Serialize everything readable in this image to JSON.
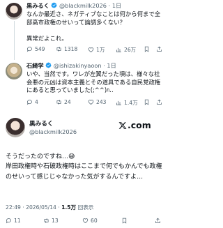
{
  "tweet1": {
    "name": "黒みるく",
    "handle": "@blackmilk2026",
    "separator": "·",
    "time": "1日",
    "text": "なんか最近さ、ネガティブなことは何から何まで全部高市政権のせいって論調多くない？\n\n異常だよこれ。",
    "stats": {
      "replies": "549",
      "reposts": "1318",
      "likes": "1万",
      "views": "26万"
    }
  },
  "tweet2": {
    "name": "石綺学",
    "handle": "@ishizakinyaoon",
    "separator": "·",
    "time": "1日",
    "text": "いや、当然です。ワレが左翼だった頃は、様々な社会悪の元凶は資本主義とその道具である自民党政権にあると思っていました(;^^)ﾊ..",
    "stats": {
      "replies": "4",
      "reposts": "24",
      "likes": "243",
      "views": "1.4万"
    }
  },
  "main": {
    "name": "黒みるく",
    "handle": "@blackmilk2026",
    "x_logo_text": ".com",
    "text": "そうだったのですね…😅\n岸田政権時や石破政権時はここまで何でもかんでも政権のせいって感じじゃなかった気がするんですよ…",
    "time": "22:49 · 2026/05/14 · ",
    "views_count": "1.5万",
    "views_label": " 回表示",
    "stats": {
      "replies": "11",
      "reposts": "13",
      "likes": "60"
    }
  },
  "colors": {
    "verified": "#1d9bf0",
    "muted": "#536471",
    "text": "#0f1419"
  },
  "icons": [
    "reply-icon",
    "repost-icon",
    "like-icon",
    "views-icon",
    "bookmark-icon",
    "share-icon",
    "verified-badge-icon",
    "x-logo-icon"
  ]
}
